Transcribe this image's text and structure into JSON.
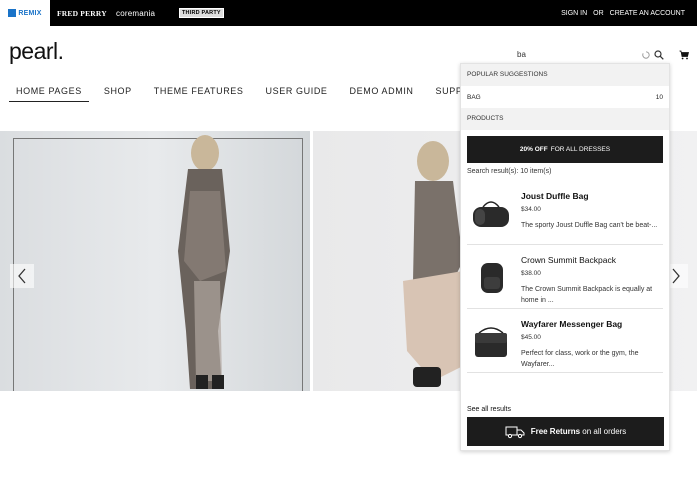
{
  "topbar": {
    "brands": [
      "REMIX",
      "FRED PERRY",
      "coremania",
      "THIRD PARTY"
    ],
    "sign_in": "SIGN IN",
    "or": "OR",
    "create_account": "CREATE AN ACCOUNT"
  },
  "header": {
    "logo": "pearl.",
    "search_value": "ba"
  },
  "nav": {
    "items": [
      "HOME PAGES",
      "SHOP",
      "THEME FEATURES",
      "USER GUIDE",
      "DEMO ADMIN",
      "SUPPORT"
    ]
  },
  "dropdown": {
    "suggestions_title": "POPULAR SUGGESTIONS",
    "suggestion": {
      "term": "BAG",
      "count": "10"
    },
    "products_title": "PRODUCTS",
    "promo_bold": "20% OFF",
    "promo_text": "FOR ALL DRESSES",
    "result_count": "Search result(s): 10 item(s)",
    "products": [
      {
        "name": "Joust Duffle Bag",
        "price": "$34.00",
        "desc": "The sporty Joust Duffle Bag can't be beat-..."
      },
      {
        "name": "Crown Summit Backpack",
        "price": "$38.00",
        "desc": "The Crown Summit Backpack is equally at home in ..."
      },
      {
        "name": "Wayfarer Messenger Bag",
        "price": "$45.00",
        "desc": "Perfect for class, work or the gym, the Wayfarer..."
      }
    ],
    "see_all": "See all results",
    "returns_bold": "Free Returns",
    "returns_text": "on all orders"
  },
  "icons": {
    "search": "search-icon",
    "cart": "cart-icon",
    "loader": "loader-icon",
    "prev": "chevron-left-icon",
    "next": "chevron-right-icon",
    "truck": "truck-icon"
  },
  "colors": {
    "topbar_bg": "#000000",
    "remix_blue": "#1a73c8",
    "dark_button": "#1c1c1c"
  }
}
